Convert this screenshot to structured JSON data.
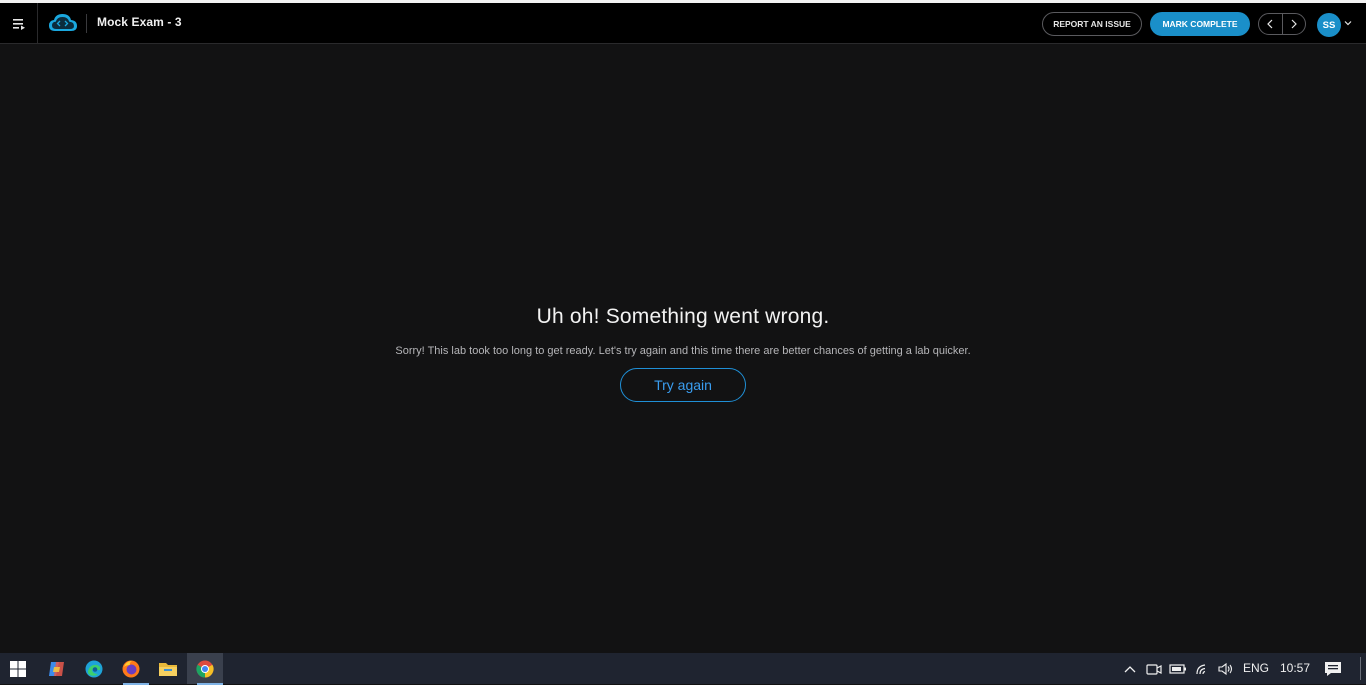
{
  "header": {
    "exam_title": "Mock Exam - 3",
    "report_label": "REPORT AN ISSUE",
    "complete_label": "MARK COMPLETE",
    "avatar_initials": "SS"
  },
  "error": {
    "title": "Uh oh! Something went wrong.",
    "message": "Sorry! This lab took too long to get ready. Let's try again and this time there are better chances of getting a lab quicker.",
    "retry_label": "Try again"
  },
  "taskbar": {
    "language": "ENG",
    "time": "10:57",
    "apps": [
      "windows-start",
      "copilot",
      "edge",
      "firefox",
      "file-explorer",
      "chrome"
    ]
  },
  "colors": {
    "accent": "#1a8fc9",
    "link": "#3a9df0",
    "background": "#121213",
    "header": "#000000"
  }
}
